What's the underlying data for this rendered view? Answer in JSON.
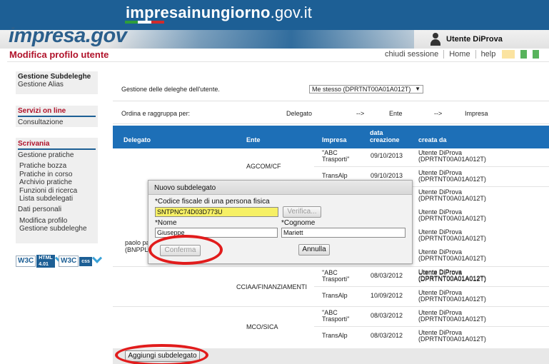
{
  "site": {
    "title_prefix": "impresa",
    "title_mid": "inungiorno",
    "title_suffix": ".gov.it",
    "logo_a": "impresa",
    "logo_b": ".gov",
    "brand_color": "#1d5f95"
  },
  "header": {
    "page_title": "Modifica profilo utente",
    "user_name": "Utente DiProva",
    "links": [
      "chiudi sessione",
      "Home",
      "help"
    ]
  },
  "sidebar": {
    "box1": {
      "title": "Gestione Subdeleghe",
      "items": [
        "Gestione Alias"
      ]
    },
    "box2": {
      "title": "Servizi on line",
      "items": [
        "Consultazione"
      ]
    },
    "box3": {
      "title": "Scrivania",
      "section1": "Gestione pratiche",
      "section1_items": [
        "Pratiche bozza",
        "Pratiche in corso",
        "Archivio pratiche",
        "Funzioni di ricerca",
        "Lista subdelegati"
      ],
      "section2": "Dati personali",
      "section2_items": [
        "Modifica profilo",
        "Gestione subdeleghe"
      ]
    },
    "badges": [
      {
        "w3": "W3C",
        "tag1": "HTML",
        "tag2": "4.01"
      },
      {
        "w3": "W3C",
        "tag1": "css",
        "tag2": ""
      }
    ]
  },
  "main": {
    "delegations_label": "Gestione delle deleghe dell'utente.",
    "delegation_select": "Me stesso (DPRTNT00A01A012T)",
    "order_label": "Ordina e raggruppa per:",
    "order_items": [
      "Delegato",
      "-->",
      "Ente",
      "-->",
      "Impresa"
    ],
    "table": {
      "headers": [
        "Delegato",
        "Ente",
        "Impresa",
        "data creazione",
        "creata da"
      ],
      "delegato_partial": [
        "paolo pao",
        "(BNPPLA"
      ],
      "rows": [
        {
          "ente": "AGCOM/CF",
          "impresa": "\"ABC Trasporti\"",
          "data": "09/10/2013",
          "creata": "Utente DiProva (DPRTNT00A01A012T)"
        },
        {
          "ente": "",
          "impresa": "TransAlp",
          "data": "09/10/2013",
          "creata": "Utente DiProva (DPRTNT00A01A012T)"
        },
        {
          "ente": "",
          "impresa": "",
          "data": "",
          "creata": "Utente DiProva (DPRTNT00A01A012T)"
        },
        {
          "ente": "",
          "impresa": "",
          "data": "",
          "creata": "Utente DiProva (DPRTNT00A01A012T)"
        },
        {
          "ente": "",
          "impresa": "",
          "data": "",
          "creata": "Utente DiProva (DPRTNT00A01A012T)"
        },
        {
          "ente": "",
          "impresa": "",
          "data": "",
          "creata": "Utente DiProva (DPRTNT00A01A012T)"
        },
        {
          "ente": "",
          "impresa": "",
          "data": "",
          "creata": "Utente DiProva (DPRTNT00A01A012T)"
        },
        {
          "ente": "CCIAA/FINANZIAMENTI",
          "impresa": "\"ABC Trasporti\"",
          "data": "08/03/2012",
          "creata": "Utente DiProva (DPRTNT00A01A012T)"
        },
        {
          "ente": "",
          "impresa": "TransAlp",
          "data": "10/09/2012",
          "creata": "Utente DiProva (DPRTNT00A01A012T)"
        },
        {
          "ente": "MCO/SICA",
          "impresa": "\"ABC Trasporti\"",
          "data": "08/03/2012",
          "creata": "Utente DiProva (DPRTNT00A01A012T)"
        },
        {
          "ente": "",
          "impresa": "TransAlp",
          "data": "08/03/2012",
          "creata": "Utente DiProva (DPRTNT00A01A012T)"
        }
      ]
    },
    "add_button": "Aggiungi subdelegato"
  },
  "dialog": {
    "title": "Nuovo subdelegato",
    "cf_label": "*Codice fiscale di una persona fisica",
    "cf_value": "SNTPNC74D03D773U",
    "verify_button": "Verifica...",
    "nome_label": "*Nome",
    "nome_value": "Giuseppe",
    "cognome_label": "*Cognome",
    "cognome_value": "Mariett",
    "confirm_button": "Conferma",
    "cancel_button": "Annulla"
  },
  "colors": {
    "table_header": "#1d6fb7",
    "title_red": "#b0122a",
    "highlight_yellow": "#f6f065",
    "annotation_red": "#e11c1c"
  }
}
